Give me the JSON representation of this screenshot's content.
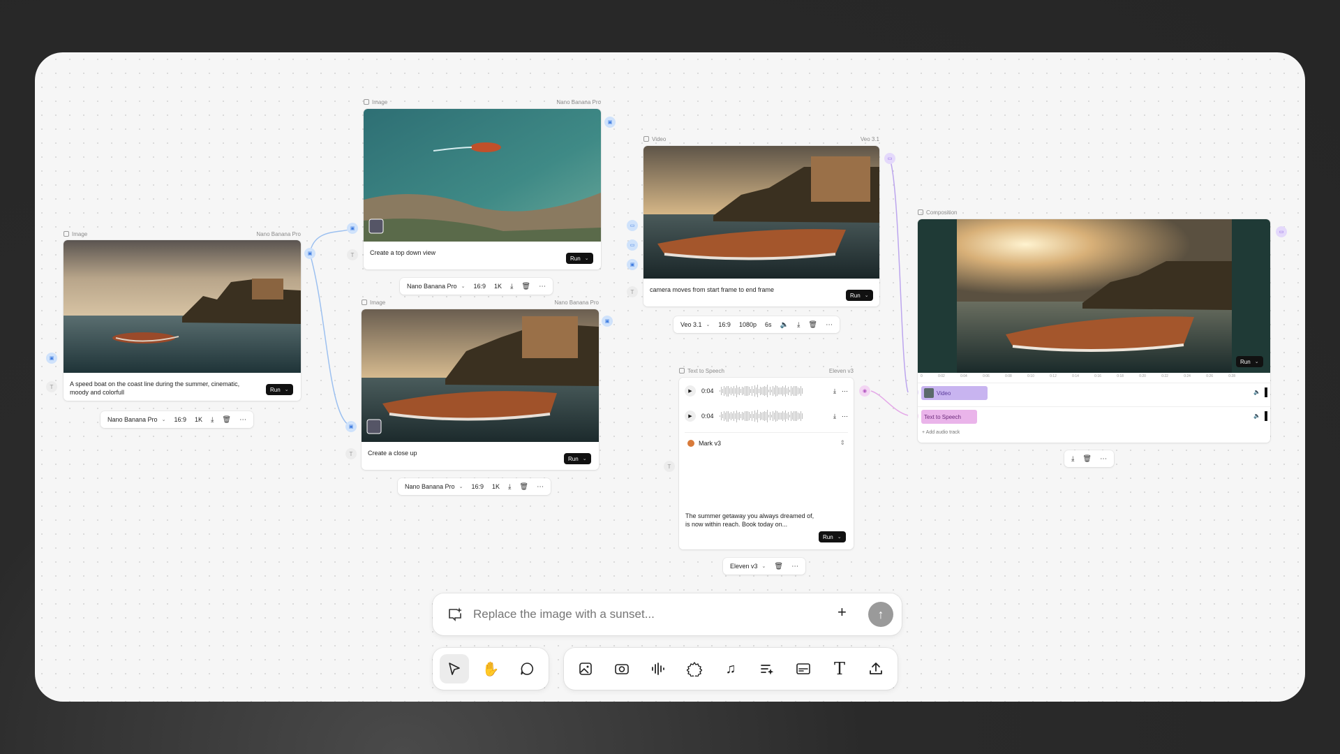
{
  "prompt_bar": {
    "placeholder": "Replace the image with a sunset...",
    "add_icon": "plus-icon",
    "send_icon": "arrow-up-icon"
  },
  "nodes": {
    "image1": {
      "type_label": "Image",
      "model_label": "Nano Banana Pro",
      "prompt": "A speed boat on the coast line during the summer, cinematic, moody and colorfull",
      "run_label": "Run",
      "toolbar": {
        "model": "Nano Banana Pro",
        "ratio": "16:9",
        "res": "1K"
      }
    },
    "image2": {
      "type_label": "Image",
      "model_label": "Nano Banana Pro",
      "prompt": "Create a top down view",
      "run_label": "Run",
      "toolbar": {
        "model": "Nano Banana Pro",
        "ratio": "16:9",
        "res": "1K"
      }
    },
    "image3": {
      "type_label": "Image",
      "model_label": "Nano Banana Pro",
      "prompt": "Create a close up",
      "run_label": "Run",
      "toolbar": {
        "model": "Nano Banana Pro",
        "ratio": "16:9",
        "res": "1K"
      }
    },
    "video": {
      "type_label": "Video",
      "model_label": "Veo 3.1",
      "prompt": "camera moves from start frame to end frame",
      "run_label": "Run",
      "toolbar": {
        "model": "Veo 3.1",
        "ratio": "16:9",
        "res": "1080p",
        "duration": "6s"
      }
    },
    "tts": {
      "type_label": "Text to Speech",
      "model_label": "Eleven v3",
      "clips": [
        {
          "time": "0:04"
        },
        {
          "time": "0:04"
        }
      ],
      "voice": "Mark v3",
      "prompt": "The summer getaway you always dreamed of, is now within reach. Book today on...",
      "run_label": "Run",
      "toolbar": {
        "model": "Eleven v3"
      }
    },
    "composition": {
      "type_label": "Composition",
      "run_label": "Run",
      "ruler": [
        "0",
        "0:02",
        "0:04",
        "0:06",
        "0:08",
        "0:10",
        "0:12",
        "0:14",
        "0:16",
        "0:18",
        "0:20",
        "0:22",
        "0:24",
        "0:26",
        "0:28"
      ],
      "tracks": [
        {
          "label": "Video"
        },
        {
          "label": "Text to Speech"
        }
      ],
      "add_track": "+ Add audio track"
    }
  },
  "tools": {
    "left": [
      "select-pointer-icon",
      "hand-icon",
      "comment-icon"
    ],
    "right": [
      "image-icon",
      "video-camera-icon",
      "audio-waveform-icon",
      "settings-gear-icon",
      "music-note-icon",
      "text-sparkle-icon",
      "composition-icon",
      "text-T-icon",
      "upload-icon"
    ]
  }
}
